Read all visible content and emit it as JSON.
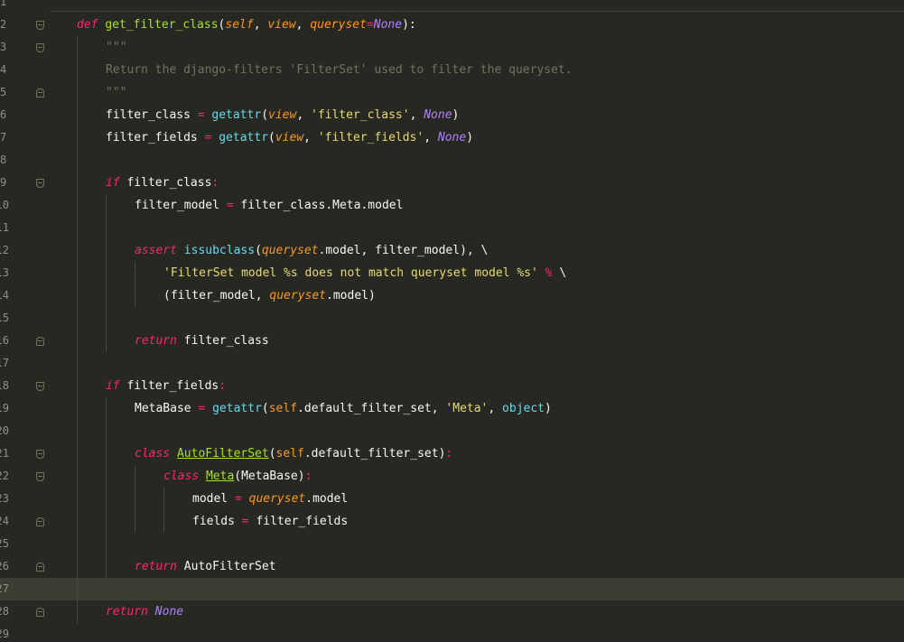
{
  "editor": {
    "lines": [
      {
        "n": "1",
        "tokens": []
      },
      {
        "n": "2",
        "fold": "open",
        "indent": 85,
        "tokens": [
          {
            "t": "def",
            "c": "def"
          },
          {
            "t": " ",
            "c": ""
          },
          {
            "t": "get_filter_class",
            "c": "fn"
          },
          {
            "t": "(",
            "c": ""
          },
          {
            "t": "self",
            "c": "param"
          },
          {
            "t": ", ",
            "c": ""
          },
          {
            "t": "view",
            "c": "param"
          },
          {
            "t": ", ",
            "c": ""
          },
          {
            "t": "queryset",
            "c": "param"
          },
          {
            "t": "=",
            "c": "op"
          },
          {
            "t": "None",
            "c": "noneit"
          },
          {
            "t": "):",
            "c": ""
          }
        ]
      },
      {
        "n": "3",
        "fold": "open",
        "indent": 117,
        "tokens": [
          {
            "t": "\"\"\"",
            "c": "comment"
          }
        ]
      },
      {
        "n": "4",
        "indent": 117,
        "tokens": [
          {
            "t": "Return the django-filters 'FilterSet' used to filter the queryset.",
            "c": "comment"
          }
        ]
      },
      {
        "n": "5",
        "fold": "close",
        "indent": 117,
        "tokens": [
          {
            "t": "\"\"\"",
            "c": "comment"
          }
        ]
      },
      {
        "n": "6",
        "indent": 117,
        "tokens": [
          {
            "t": "filter_class",
            "c": ""
          },
          {
            "t": " = ",
            "c": "op"
          },
          {
            "t": "getattr",
            "c": "builtin"
          },
          {
            "t": "(",
            "c": ""
          },
          {
            "t": "view",
            "c": "param"
          },
          {
            "t": ", ",
            "c": ""
          },
          {
            "t": "'filter_class'",
            "c": "str"
          },
          {
            "t": ", ",
            "c": ""
          },
          {
            "t": "None",
            "c": "noneit"
          },
          {
            "t": ")",
            "c": ""
          }
        ]
      },
      {
        "n": "7",
        "indent": 117,
        "tokens": [
          {
            "t": "filter_fields",
            "c": ""
          },
          {
            "t": " = ",
            "c": "op"
          },
          {
            "t": "getattr",
            "c": "builtin"
          },
          {
            "t": "(",
            "c": ""
          },
          {
            "t": "view",
            "c": "param"
          },
          {
            "t": ", ",
            "c": ""
          },
          {
            "t": "'filter_fields'",
            "c": "str"
          },
          {
            "t": ", ",
            "c": ""
          },
          {
            "t": "None",
            "c": "noneit"
          },
          {
            "t": ")",
            "c": ""
          }
        ]
      },
      {
        "n": "8",
        "tokens": []
      },
      {
        "n": "9",
        "fold": "open",
        "indent": 117,
        "tokens": [
          {
            "t": "if",
            "c": "kw"
          },
          {
            "t": " filter_class",
            "c": ""
          },
          {
            "t": ":",
            "c": "op"
          }
        ]
      },
      {
        "n": "10",
        "indent": 149,
        "tokens": [
          {
            "t": "filter_model",
            "c": ""
          },
          {
            "t": " = ",
            "c": "op"
          },
          {
            "t": "filter_class.Meta.model",
            "c": ""
          }
        ]
      },
      {
        "n": "11",
        "tokens": []
      },
      {
        "n": "12",
        "indent": 149,
        "tokens": [
          {
            "t": "assert",
            "c": "kw"
          },
          {
            "t": " ",
            "c": ""
          },
          {
            "t": "issubclass",
            "c": "builtin"
          },
          {
            "t": "(",
            "c": ""
          },
          {
            "t": "queryset",
            "c": "param"
          },
          {
            "t": ".model, filter_model)",
            "c": ""
          },
          {
            "t": ",",
            "c": ""
          },
          {
            "t": " \\",
            "c": ""
          }
        ]
      },
      {
        "n": "13",
        "indent": 181,
        "tokens": [
          {
            "t": "'FilterSet model %s does not match queryset model %s'",
            "c": "str"
          },
          {
            "t": " % ",
            "c": "op"
          },
          {
            "t": "\\",
            "c": ""
          }
        ]
      },
      {
        "n": "14",
        "indent": 181,
        "tokens": [
          {
            "t": "(filter_model, ",
            "c": ""
          },
          {
            "t": "queryset",
            "c": "param"
          },
          {
            "t": ".model)",
            "c": ""
          }
        ]
      },
      {
        "n": "15",
        "tokens": []
      },
      {
        "n": "16",
        "fold": "close",
        "indent": 149,
        "tokens": [
          {
            "t": "return",
            "c": "kw"
          },
          {
            "t": " filter_class",
            "c": ""
          }
        ]
      },
      {
        "n": "17",
        "tokens": []
      },
      {
        "n": "18",
        "fold": "open",
        "indent": 117,
        "tokens": [
          {
            "t": "if",
            "c": "kw"
          },
          {
            "t": " filter_fields",
            "c": ""
          },
          {
            "t": ":",
            "c": "op"
          }
        ]
      },
      {
        "n": "19",
        "indent": 149,
        "tokens": [
          {
            "t": "MetaBase",
            "c": ""
          },
          {
            "t": " = ",
            "c": "op"
          },
          {
            "t": "getattr",
            "c": "builtin"
          },
          {
            "t": "(",
            "c": ""
          },
          {
            "t": "self",
            "c": "self"
          },
          {
            "t": ".default_filter_set, ",
            "c": ""
          },
          {
            "t": "'Meta'",
            "c": "str"
          },
          {
            "t": ", ",
            "c": ""
          },
          {
            "t": "object",
            "c": "builtin"
          },
          {
            "t": ")",
            "c": ""
          }
        ]
      },
      {
        "n": "20",
        "tokens": []
      },
      {
        "n": "21",
        "fold": "open",
        "indent": 149,
        "tokens": [
          {
            "t": "class",
            "c": "kw"
          },
          {
            "t": " ",
            "c": ""
          },
          {
            "t": "AutoFilterSet",
            "c": "cls"
          },
          {
            "t": "(",
            "c": ""
          },
          {
            "t": "self",
            "c": "self"
          },
          {
            "t": ".default_filter_set)",
            "c": ""
          },
          {
            "t": ":",
            "c": "op"
          }
        ]
      },
      {
        "n": "22",
        "fold": "open",
        "indent": 181,
        "tokens": [
          {
            "t": "class",
            "c": "kw"
          },
          {
            "t": " ",
            "c": ""
          },
          {
            "t": "Meta",
            "c": "cls"
          },
          {
            "t": "(MetaBase)",
            "c": ""
          },
          {
            "t": ":",
            "c": "op"
          }
        ]
      },
      {
        "n": "23",
        "indent": 213,
        "tokens": [
          {
            "t": "model",
            "c": ""
          },
          {
            "t": " = ",
            "c": "op"
          },
          {
            "t": "queryset",
            "c": "param"
          },
          {
            "t": ".model",
            "c": ""
          }
        ]
      },
      {
        "n": "24",
        "fold": "close",
        "indent": 213,
        "tokens": [
          {
            "t": "fields",
            "c": ""
          },
          {
            "t": " = ",
            "c": "op"
          },
          {
            "t": "filter_fields",
            "c": ""
          }
        ]
      },
      {
        "n": "25",
        "tokens": []
      },
      {
        "n": "26",
        "fold": "close",
        "indent": 149,
        "tokens": [
          {
            "t": "return",
            "c": "kw"
          },
          {
            "t": " AutoFilterSet",
            "c": ""
          }
        ]
      },
      {
        "n": "27",
        "current": true,
        "tokens": []
      },
      {
        "n": "28",
        "fold": "close",
        "indent": 117,
        "tokens": [
          {
            "t": "return",
            "c": "kw"
          },
          {
            "t": " ",
            "c": ""
          },
          {
            "t": "None",
            "c": "noneit"
          }
        ]
      },
      {
        "n": "29",
        "tokens": []
      }
    ]
  }
}
